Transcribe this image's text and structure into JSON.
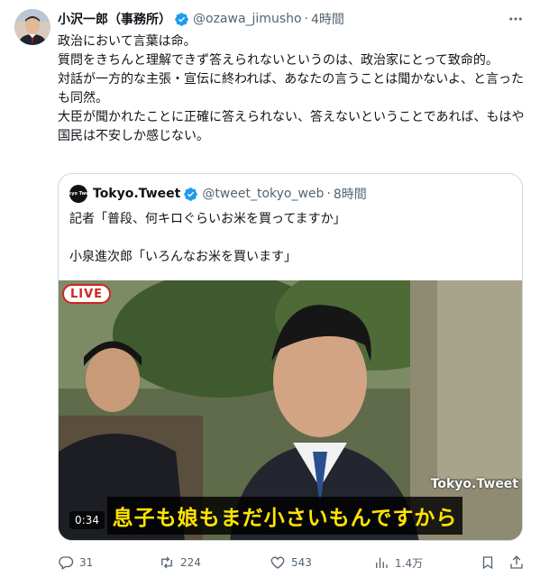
{
  "tweet": {
    "author_name": "小沢一郎（事務所）",
    "author_handle": "@ozawa_jimusho",
    "separator": "·",
    "time": "4時間",
    "text": "政治において言葉は命。\n質問をきちんと理解できず答えられないというのは、政治家にとって致命的。\n対話が一方的な主張・宣伝に終われば、あなたの言うことは聞かないよ、と言ったも同然。\n大臣が聞かれたことに正確に答えられない、答えないということであれば、もはや国民は不安しか感じない。"
  },
  "quote": {
    "avatar_text": "Tokyo Tweet",
    "author_name": "Tokyo.Tweet",
    "author_handle": "@tweet_tokyo_web",
    "separator": "·",
    "time": "8時間",
    "text": "記者「普段、何キロぐらいお米を買ってますか」\n\n小泉進次郎「いろんなお米を買います」",
    "video": {
      "live_badge": "LIVE",
      "watermark": "Tokyo.Tweet",
      "caption": "息子も娘もまだ小さいもんですから",
      "duration": "0:34"
    }
  },
  "actions": {
    "replies": "31",
    "reposts": "224",
    "likes": "543",
    "views": "1.4万"
  },
  "colors": {
    "verified": "#1d9bf0",
    "secondary_text": "#536471",
    "caption_text": "#ffe400",
    "live_red": "#d0251e"
  }
}
